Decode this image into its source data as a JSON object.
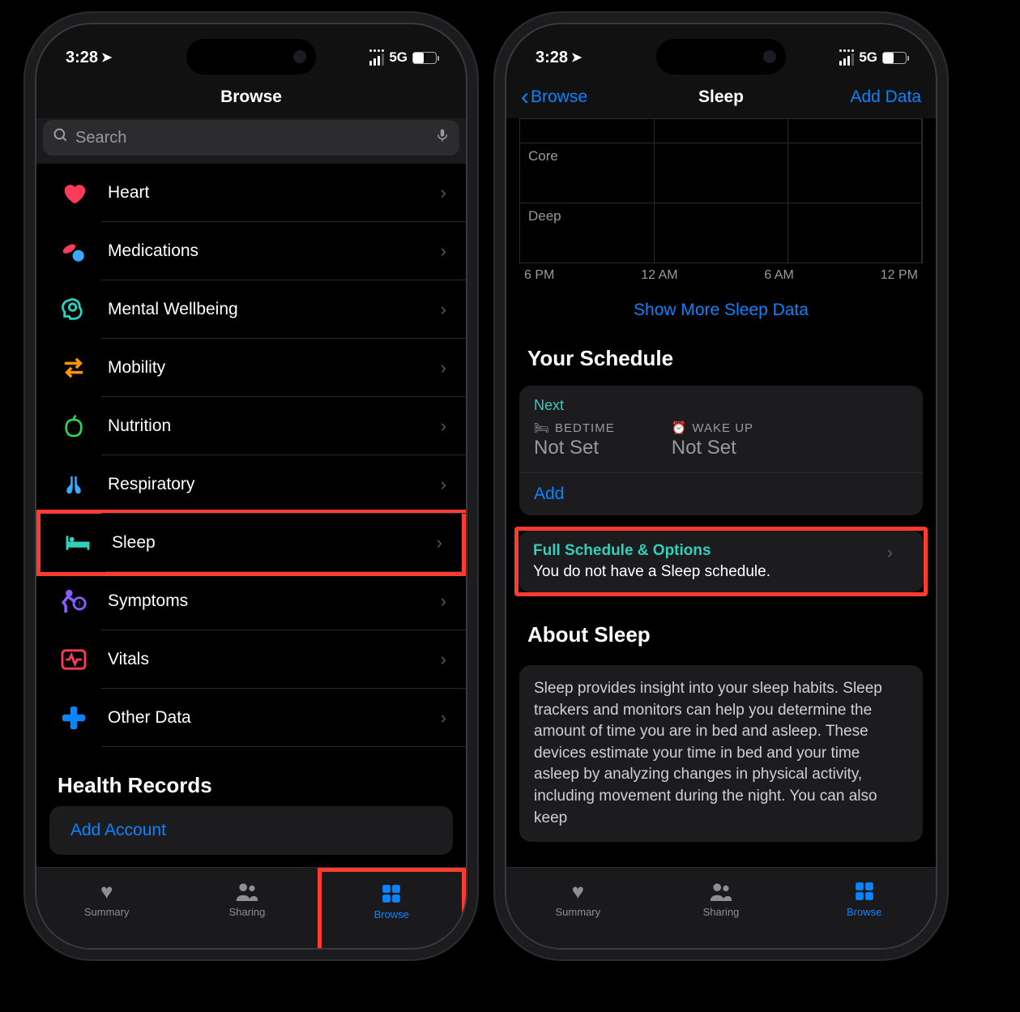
{
  "status": {
    "time": "3:28",
    "network": "5G"
  },
  "browse": {
    "title": "Browse",
    "search_placeholder": "Search",
    "categories": [
      {
        "id": "heart",
        "label": "Heart",
        "color": "#ff3b5c"
      },
      {
        "id": "medications",
        "label": "Medications",
        "color": "#3ba7ff"
      },
      {
        "id": "mental",
        "label": "Mental Wellbeing",
        "color": "#30d0bb"
      },
      {
        "id": "mobility",
        "label": "Mobility",
        "color": "#ff9500"
      },
      {
        "id": "nutrition",
        "label": "Nutrition",
        "color": "#30d158"
      },
      {
        "id": "respiratory",
        "label": "Respiratory",
        "color": "#3ba7ff"
      },
      {
        "id": "sleep",
        "label": "Sleep",
        "color": "#30d0bb"
      },
      {
        "id": "symptoms",
        "label": "Symptoms",
        "color": "#8a5cff"
      },
      {
        "id": "vitals",
        "label": "Vitals",
        "color": "#ff3b5c"
      },
      {
        "id": "other",
        "label": "Other Data",
        "color": "#0a84ff"
      }
    ],
    "records_header": "Health Records",
    "add_account": "Add Account"
  },
  "tabs": {
    "summary": "Summary",
    "sharing": "Sharing",
    "browse": "Browse"
  },
  "sleep": {
    "back": "Browse",
    "title": "Sleep",
    "add_data": "Add Data",
    "stages": [
      "Core",
      "Deep"
    ],
    "axis": [
      "6 PM",
      "12 AM",
      "6 AM",
      "12 PM"
    ],
    "show_more": "Show More Sleep Data",
    "schedule_header": "Your Schedule",
    "next_label": "Next",
    "bedtime_label": "BEDTIME",
    "wakeup_label": "WAKE UP",
    "bedtime_value": "Not Set",
    "wakeup_value": "Not Set",
    "add": "Add",
    "full_title": "Full Schedule & Options",
    "full_subtitle": "You do not have a Sleep schedule.",
    "about_header": "About Sleep",
    "about_body": "Sleep provides insight into your sleep habits. Sleep trackers and monitors can help you determine the amount of time you are in bed and asleep. These devices estimate your time in bed and your time asleep by analyzing changes in physical activity, including movement during the night. You can also keep"
  }
}
